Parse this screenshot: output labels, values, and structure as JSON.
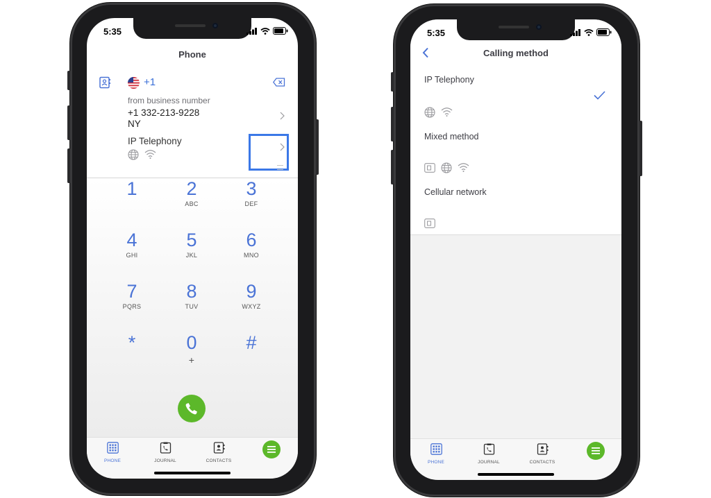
{
  "left_screen": {
    "status_time": "5:35",
    "title": "Phone",
    "country_code": "+1",
    "from_label": "from business number",
    "business_number": "+1 332-213-9228",
    "region": "NY",
    "calling_method": "IP Telephony",
    "keypad": [
      {
        "digit": "1",
        "letters": ""
      },
      {
        "digit": "2",
        "letters": "ABC"
      },
      {
        "digit": "3",
        "letters": "DEF"
      },
      {
        "digit": "4",
        "letters": "GHI"
      },
      {
        "digit": "5",
        "letters": "JKL"
      },
      {
        "digit": "6",
        "letters": "MNO"
      },
      {
        "digit": "7",
        "letters": "PQRS"
      },
      {
        "digit": "8",
        "letters": "TUV"
      },
      {
        "digit": "9",
        "letters": "WXYZ"
      },
      {
        "digit": "*",
        "letters": ""
      },
      {
        "digit": "0",
        "letters": "+"
      },
      {
        "digit": "#",
        "letters": ""
      }
    ],
    "tabs": [
      {
        "label": "PHONE",
        "icon": "dialpad-icon",
        "active": true
      },
      {
        "label": "JOURNAL",
        "icon": "journal-icon",
        "active": false
      },
      {
        "label": "CONTACTS",
        "icon": "contacts-icon",
        "active": false
      },
      {
        "label": "",
        "icon": "menu-icon",
        "active": false
      }
    ]
  },
  "right_screen": {
    "status_time": "5:35",
    "title": "Calling method",
    "options": [
      {
        "label": "IP Telephony",
        "selected": true,
        "icons": [
          "globe-icon",
          "wifi-icon"
        ]
      },
      {
        "label": "Mixed method",
        "selected": false,
        "icons": [
          "sim-icon",
          "globe-icon",
          "wifi-icon"
        ]
      },
      {
        "label": "Cellular network",
        "selected": false,
        "icons": [
          "sim-icon"
        ]
      }
    ],
    "tabs": [
      {
        "label": "PHONE",
        "icon": "dialpad-icon",
        "active": true
      },
      {
        "label": "JOURNAL",
        "icon": "journal-icon",
        "active": false
      },
      {
        "label": "CONTACTS",
        "icon": "contacts-icon",
        "active": false
      },
      {
        "label": "",
        "icon": "menu-icon",
        "active": false
      }
    ]
  },
  "colors": {
    "accent": "#4a73d6",
    "call_button": "#5cb82a",
    "highlight_box": "#3b78e7",
    "background_gray": "#f2f2f2"
  }
}
